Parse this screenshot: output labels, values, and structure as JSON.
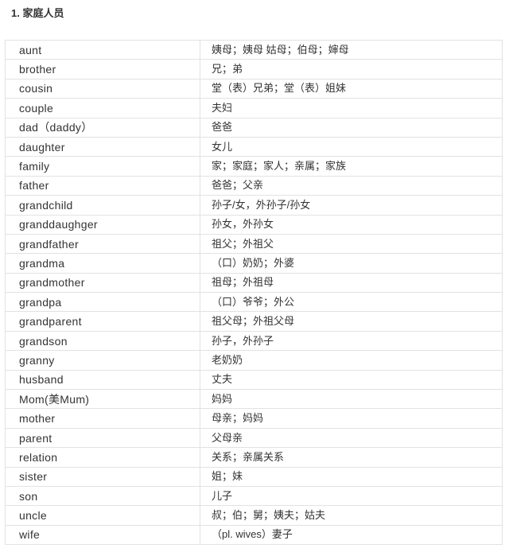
{
  "section": {
    "title": "1. 家庭人员"
  },
  "table": {
    "rows": [
      {
        "en": "aunt",
        "zh": "姨母；姨母 姑母；伯母；婶母"
      },
      {
        "en": "brother",
        "zh": "兄；弟"
      },
      {
        "en": "cousin",
        "zh": "堂（表）兄弟；堂（表）姐妹"
      },
      {
        "en": "couple",
        "zh": "夫妇"
      },
      {
        "en": "dad（daddy）",
        "zh": "爸爸"
      },
      {
        "en": "daughter",
        "zh": "女儿"
      },
      {
        "en": "family",
        "zh": "家；家庭；家人；亲属；家族"
      },
      {
        "en": "father",
        "zh": "爸爸；父亲"
      },
      {
        "en": "grandchild",
        "zh": "孙子/女，外孙子/孙女"
      },
      {
        "en": "granddaughger",
        "zh": "孙女，外孙女"
      },
      {
        "en": "grandfather",
        "zh": "祖父；外祖父"
      },
      {
        "en": "grandma",
        "zh": "（口）奶奶；外婆"
      },
      {
        "en": "grandmother",
        "zh": "祖母；外祖母"
      },
      {
        "en": "grandpa",
        "zh": "（口）爷爷；外公"
      },
      {
        "en": "grandparent",
        "zh": "祖父母；外祖父母"
      },
      {
        "en": "grandson",
        "zh": "孙子，外孙子"
      },
      {
        "en": "granny",
        "zh": "老奶奶"
      },
      {
        "en": "husband",
        "zh": "丈夫"
      },
      {
        "en": "Mom(美Mum)",
        "zh": "妈妈"
      },
      {
        "en": "mother",
        "zh": "母亲；妈妈"
      },
      {
        "en": "parent",
        "zh": "父母亲"
      },
      {
        "en": "relation",
        "zh": "关系；亲属关系"
      },
      {
        "en": "sister",
        "zh": "姐；妹"
      },
      {
        "en": "son",
        "zh": "儿子"
      },
      {
        "en": "uncle",
        "zh": "叔；伯；舅；姨夫；姑夫"
      },
      {
        "en": "wife",
        "zh": "（pl. wives）妻子"
      }
    ]
  }
}
